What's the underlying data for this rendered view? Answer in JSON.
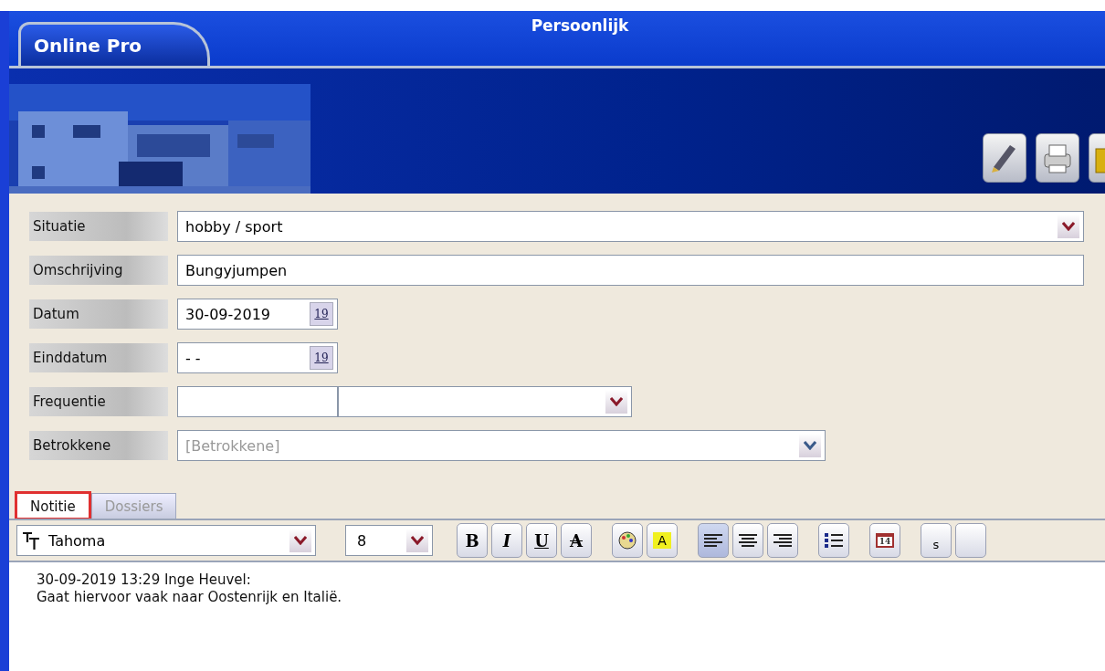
{
  "app": {
    "tab": "Online Pro",
    "title": "Persoonlijk"
  },
  "header_tools": [
    {
      "kind": "pen"
    },
    {
      "kind": "print"
    },
    {
      "kind": "folder"
    }
  ],
  "form": [
    {
      "label": "Situatie",
      "kind": "select",
      "value": "hobby / sport"
    },
    {
      "label": "Omschrijving",
      "kind": "text",
      "value": "Bungyjumpen"
    },
    {
      "label": "Datum",
      "kind": "date",
      "value": "30-09-2019",
      "calendar_label": "19"
    },
    {
      "label": "Einddatum",
      "kind": "date",
      "value": "- -",
      "calendar_label": "19"
    },
    {
      "label": "Frequentie",
      "kind": "split"
    },
    {
      "label": "Betrokkene",
      "kind": "combo",
      "placeholder": "[Betrokkene]"
    }
  ],
  "tabs": [
    {
      "label": "Notitie",
      "selected": true,
      "highlighted": true
    },
    {
      "label": "Dossiers",
      "selected": false,
      "highlighted": false
    }
  ],
  "editor_toolbar": {
    "font": "Tahoma",
    "size": "8",
    "buttons": [
      {
        "kind": "bold",
        "label": "B",
        "selected": false
      },
      {
        "kind": "italic",
        "label": "I",
        "selected": false
      },
      {
        "kind": "underline",
        "label": "U",
        "selected": false
      },
      {
        "kind": "strike",
        "label": "A",
        "selected": false
      },
      {
        "kind": "palette",
        "selected": false
      },
      {
        "kind": "highlight",
        "label": "A",
        "selected": false
      },
      {
        "kind": "align-left",
        "selected": true
      },
      {
        "kind": "align-center",
        "selected": false
      },
      {
        "kind": "align-right",
        "selected": false
      },
      {
        "kind": "list",
        "selected": false
      },
      {
        "kind": "calendar",
        "label": "14",
        "selected": false
      },
      {
        "kind": "text",
        "label": "s",
        "selected": false
      },
      {
        "kind": "blank",
        "selected": false
      }
    ]
  },
  "note": [
    "30-09-2019 13:29 Inge Heuvel:",
    "Gaat hiervoor vaak naar Oostenrijk en Italië."
  ]
}
